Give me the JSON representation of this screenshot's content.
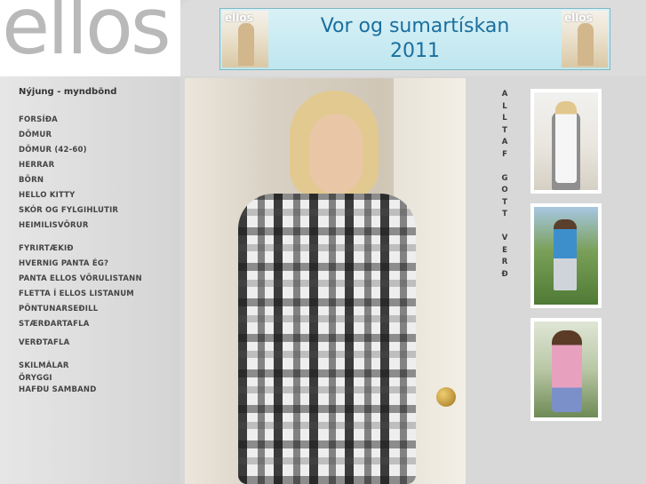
{
  "logo": {
    "text": "ellos"
  },
  "banner": {
    "line1": "Vor og sumartískan",
    "line2": "2011",
    "thumb_text": "ellos"
  },
  "nav": {
    "title": "Nýjung - myndbönd",
    "items": [
      "FORSÍÐA",
      "DÖMUR",
      "DÖMUR (42-60)",
      "HERRAR",
      "BÖRN",
      "HELLO KITTY",
      "SKÓR OG FYLGIHLUTIR",
      "HEIMILISVÖRUR",
      "FYRIRTÆKIÐ",
      "HVERNIG PANTA ÉG?",
      "PANTA ELLOS VÖRULISTANN",
      "FLETTA Í ELLOS LISTANUM",
      "PÖNTUNARSEÐILL",
      "STÆRÐARTAFLA",
      "VERÐTAFLA",
      "SKILMÁLAR",
      "ÖRYGGI",
      "HAFÐU SAMBAND"
    ]
  },
  "vertical_text": {
    "word1": [
      "A",
      "L",
      "L",
      "T",
      "A",
      "F"
    ],
    "word2": [
      "G",
      "O",
      "T",
      "T"
    ],
    "word3": [
      "V",
      "E",
      "R",
      "Ð"
    ]
  },
  "colors": {
    "logo_gray": "#b9b9b9",
    "banner_text": "#1a6f9e",
    "banner_bg": "#c9ebf2",
    "page_bg": "#d8d8d8"
  }
}
